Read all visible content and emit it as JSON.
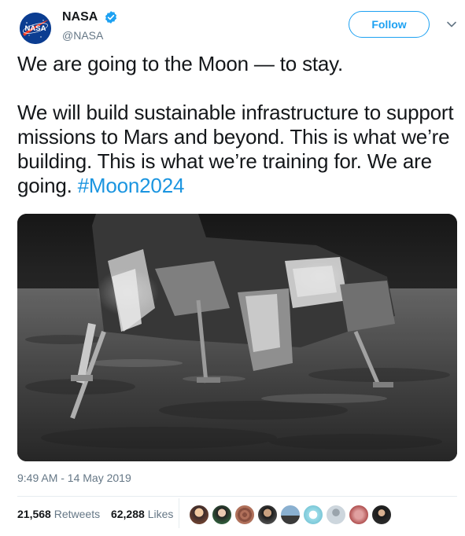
{
  "account": {
    "display_name": "NASA",
    "handle": "@NASA",
    "avatar_text": "NASA",
    "verified_icon": "verified-badge-icon",
    "follow_label": "Follow"
  },
  "tweet": {
    "line1": "We are going to the Moon — to stay.",
    "body": "We will build sustainable infrastructure to support missions to Mars and beyond. This is what we’re building. This is what we’re training for. We are going.",
    "hashtag": "#Moon2024",
    "timestamp": "9:49 AM - 14 May 2019"
  },
  "stats": {
    "retweets_count": "21,568",
    "retweets_label": "Retweets",
    "likes_count": "62,288",
    "likes_label": "Likes"
  },
  "colors": {
    "accent": "#1da1f2",
    "hashtag": "#1b95e0",
    "text": "#14171a",
    "muted": "#657786"
  }
}
